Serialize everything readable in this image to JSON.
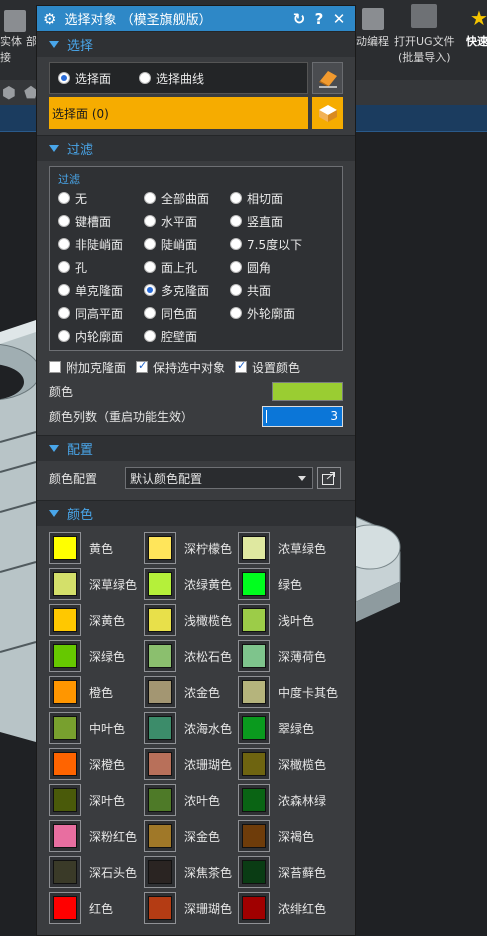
{
  "background": {
    "toolbar_left": [
      "实体",
      "部",
      "接"
    ],
    "toolbar_items": [
      {
        "label": "动编程"
      },
      {
        "label": "打开UG文件",
        "sub": "(批量导入)"
      },
      {
        "label": "快速"
      }
    ]
  },
  "dialog": {
    "title": "选择对象 （模圣旗舰版）",
    "icons": {
      "reset": "reset-icon",
      "help": "help-icon",
      "close": "close-icon",
      "settings": "gear-icon"
    },
    "select_section": {
      "header": "选择",
      "option_face": "选择面",
      "option_curve": "选择曲线",
      "selected_option": "选择面",
      "selection_status": "选择面 (0)"
    },
    "filter_section": {
      "header": "过滤",
      "legend": "过滤",
      "options": [
        "无",
        "全部曲面",
        "相切面",
        "键槽面",
        "水平面",
        "竖直面",
        "非陡峭面",
        "陡峭面",
        "7.5度以下",
        "孔",
        "面上孔",
        "圆角",
        "单克隆面",
        "多克隆面",
        "共面",
        "同高平面",
        "同色面",
        "外轮廓面",
        "内轮廓面",
        "腔壁面"
      ],
      "selected": "多克隆面",
      "checkboxes": [
        {
          "label": "附加克隆面",
          "checked": false
        },
        {
          "label": "保持选中对象",
          "checked": true
        },
        {
          "label": "设置颜色",
          "checked": true
        }
      ],
      "color_label": "颜色",
      "color_value": "#9acd32",
      "columns_label": "颜色列数（重启功能生效）",
      "columns_value": "3"
    },
    "config_section": {
      "header": "配置",
      "label": "颜色配置",
      "value": "默认颜色配置"
    },
    "color_section": {
      "header": "颜色",
      "colors": [
        {
          "name": "黄色",
          "hex": "#ffff00"
        },
        {
          "name": "深柠檬色",
          "hex": "#ffe55a"
        },
        {
          "name": "浓草绿色",
          "hex": "#dfe8a0"
        },
        {
          "name": "深草绿色",
          "hex": "#d4e06a"
        },
        {
          "name": "浓绿黄色",
          "hex": "#b5f03a"
        },
        {
          "name": "绿色",
          "hex": "#00ff1e"
        },
        {
          "name": "深黄色",
          "hex": "#ffc800"
        },
        {
          "name": "浅橄榄色",
          "hex": "#e8e04a"
        },
        {
          "name": "浅叶色",
          "hex": "#9ccc48"
        },
        {
          "name": "深绿色",
          "hex": "#66c800"
        },
        {
          "name": "浓松石色",
          "hex": "#8bbf6e"
        },
        {
          "name": "深薄荷色",
          "hex": "#7ec48c"
        },
        {
          "name": "橙色",
          "hex": "#ff9600"
        },
        {
          "name": "浓金色",
          "hex": "#a39672"
        },
        {
          "name": "中度卡其色",
          "hex": "#b5b47c"
        },
        {
          "name": "中叶色",
          "hex": "#78a02e"
        },
        {
          "name": "浓海水色",
          "hex": "#3c8c6a"
        },
        {
          "name": "翠绿色",
          "hex": "#0a9a1e"
        },
        {
          "name": "深橙色",
          "hex": "#ff6400"
        },
        {
          "name": "浓珊瑚色",
          "hex": "#b8705a"
        },
        {
          "name": "深橄榄色",
          "hex": "#6e6410"
        },
        {
          "name": "深叶色",
          "hex": "#4a5a0a"
        },
        {
          "name": "浓叶色",
          "hex": "#4e7a28"
        },
        {
          "name": "浓森林绿",
          "hex": "#0a6414"
        },
        {
          "name": "深粉红色",
          "hex": "#e86ea0"
        },
        {
          "name": "深金色",
          "hex": "#a07828"
        },
        {
          "name": "深褐色",
          "hex": "#6e3c0a"
        },
        {
          "name": "深石头色",
          "hex": "#3a3a28"
        },
        {
          "name": "深焦茶色",
          "hex": "#2a2422"
        },
        {
          "name": "深苔藓色",
          "hex": "#0a3c14"
        },
        {
          "name": "红色",
          "hex": "#ff0000"
        },
        {
          "name": "深珊瑚色",
          "hex": "#b43c14"
        },
        {
          "name": "浓绯红色",
          "hex": "#a00000"
        }
      ]
    }
  }
}
